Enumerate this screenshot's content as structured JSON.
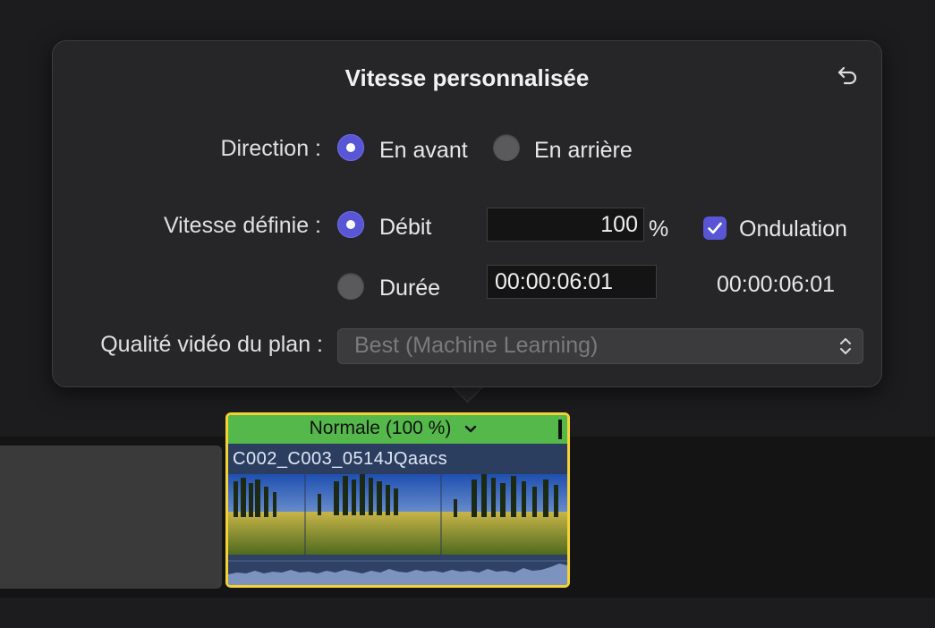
{
  "popover": {
    "title": "Vitesse personnalisée",
    "direction": {
      "label": "Direction :",
      "options": [
        {
          "label": "En avant",
          "selected": true
        },
        {
          "label": "En arrière",
          "selected": false
        }
      ]
    },
    "set_speed": {
      "label": "Vitesse définie :",
      "rate_option": {
        "label": "Débit",
        "selected": true
      },
      "rate_value": "100",
      "rate_unit": "%",
      "ripple": {
        "label": "Ondulation",
        "checked": true
      },
      "duration_option": {
        "label": "Durée",
        "selected": false
      },
      "duration_value": "00:00:06:01",
      "duration_readout": "00:00:06:01"
    },
    "quality": {
      "label": "Qualité vidéo du plan :",
      "value": "Best (Machine Learning)"
    }
  },
  "clip": {
    "speed_label": "Normale (100 %)",
    "name": "C002_C003_0514JQaacs"
  },
  "colors": {
    "accent": "#5956d6",
    "clip_border": "#f3d232",
    "speed_bar": "#54b84a"
  }
}
